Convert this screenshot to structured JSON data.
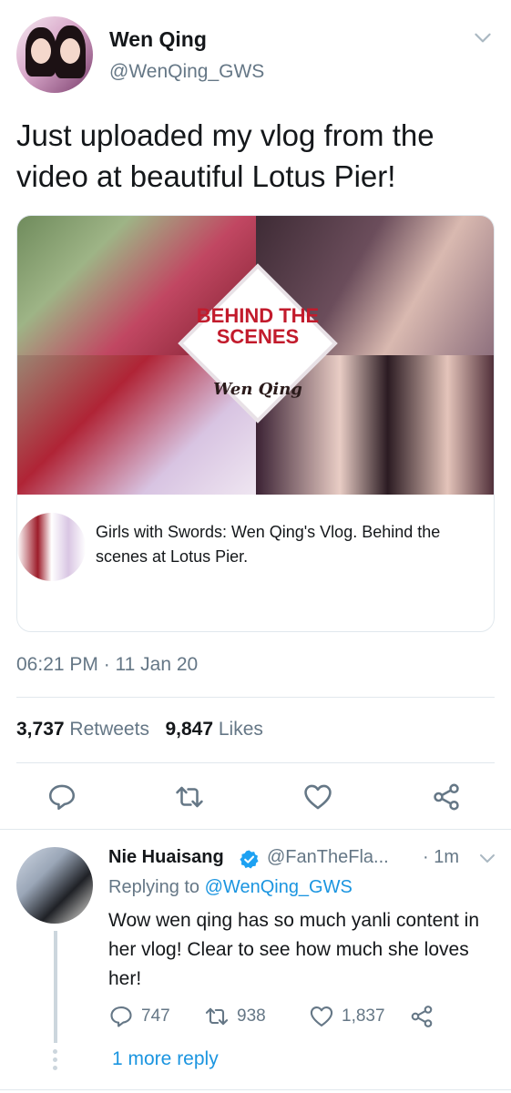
{
  "tweet": {
    "author_name": "Wen Qing",
    "author_handle": "@WenQing_GWS",
    "text": "Just uploaded my vlog from the video at beautiful Lotus Pier!",
    "card": {
      "image_text": "BEHIND THE SCENES",
      "image_script": "Wen Qing",
      "title": "Girls with Swords: Wen Qing's Vlog. Behind the scenes at Lotus Pier."
    },
    "timestamp": "06:21 PM · 11 Jan 20",
    "retweets_count": "3,737",
    "retweets_label": "Retweets",
    "likes_count": "9,847",
    "likes_label": "Likes"
  },
  "reply": {
    "author_name": "Nie Huaisang",
    "author_handle": "@FanTheFla...",
    "time": "· 1m",
    "replying_prefix": "Replying to",
    "replying_handle": "@WenQing_GWS",
    "text": "Wow wen qing has so much yanli content in her vlog! Clear to see how much she loves her!",
    "reply_count": "747",
    "retweet_count": "938",
    "like_count": "1,837"
  },
  "more_replies": "1 more reply",
  "icons": {
    "reply": "reply-icon",
    "retweet": "retweet-icon",
    "like": "heart-icon",
    "share": "share-icon",
    "menu": "chevron-down-icon",
    "verified": "verified-icon"
  },
  "colors": {
    "link": "#1b95e0",
    "secondary": "#657786",
    "primary_text": "#14171a",
    "divider": "#e1e8ed"
  }
}
